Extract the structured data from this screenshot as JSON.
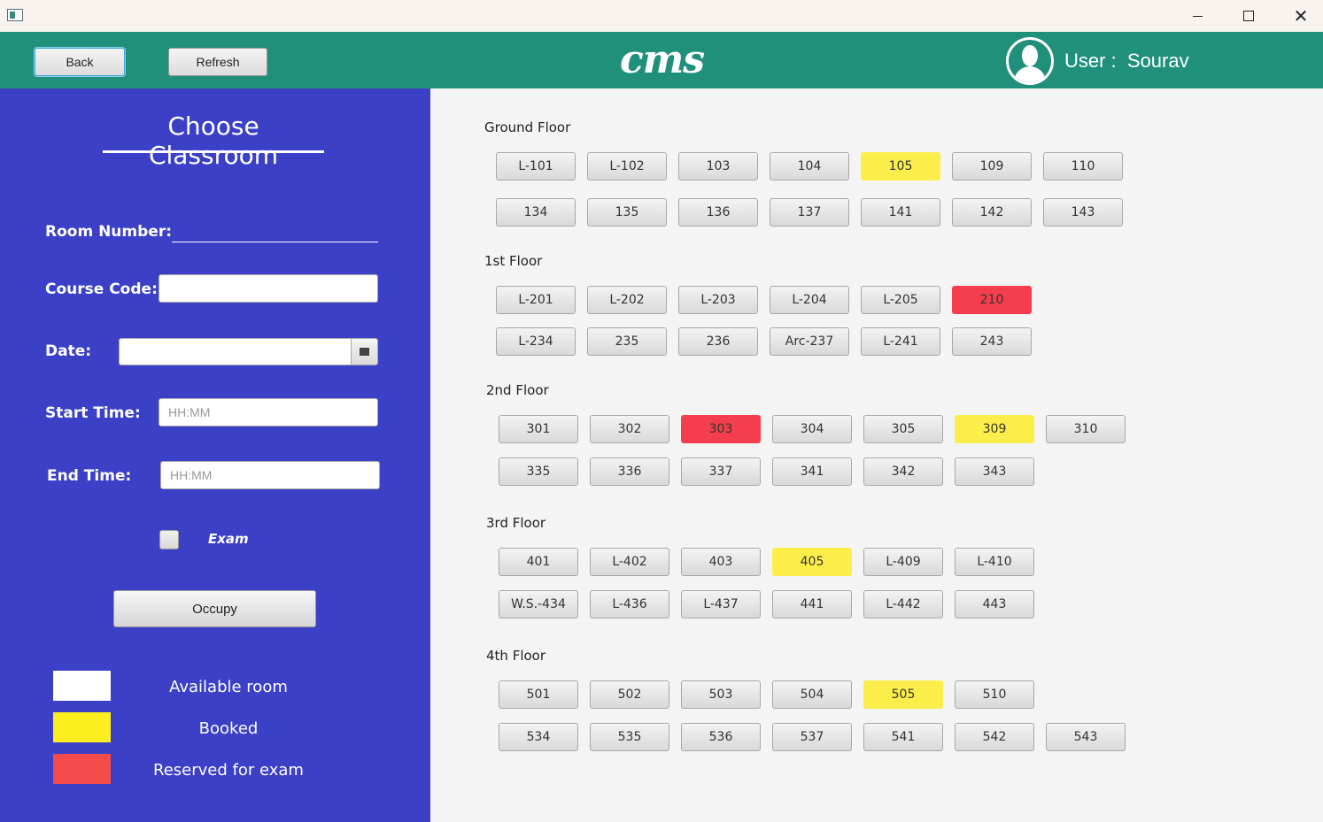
{
  "window": {
    "minimize_icon": "minimize-icon",
    "maximize_icon": "maximize-icon",
    "close_glyph": "✕"
  },
  "header": {
    "back_label": "Back",
    "refresh_label": "Refresh",
    "logo_text": "cms",
    "user_text": "User :  Sourav",
    "background": "#21907a"
  },
  "sidebar": {
    "title": "Choose Classroom",
    "room_number_label": "Room Number:",
    "course_code_label": "Course Code:",
    "date_label": "Date:",
    "start_time_label": "Start Time:",
    "start_time_placeholder": "HH:MM",
    "end_time_label": "End Time:",
    "end_time_placeholder": "HH:MM",
    "exam_label": "Exam",
    "occupy_label": "Occupy",
    "background": "#3c40c6",
    "legend": [
      {
        "label": "Available room",
        "color": "#ffffff"
      },
      {
        "label": "Booked",
        "color": "#fcee1e"
      },
      {
        "label": "Reserved for exam",
        "color": "#f44a4a"
      }
    ]
  },
  "floors": [
    {
      "label": "Ground Floor",
      "rows": [
        [
          {
            "name": "L-101",
            "status": "available"
          },
          {
            "name": "L-102",
            "status": "available"
          },
          {
            "name": "103",
            "status": "available"
          },
          {
            "name": "104",
            "status": "available"
          },
          {
            "name": "105",
            "status": "booked"
          },
          {
            "name": "109",
            "status": "available"
          },
          {
            "name": "110",
            "status": "available"
          }
        ],
        [
          {
            "name": "134",
            "status": "available"
          },
          {
            "name": "135",
            "status": "available"
          },
          {
            "name": "136",
            "status": "available"
          },
          {
            "name": "137",
            "status": "available"
          },
          {
            "name": "141",
            "status": "available"
          },
          {
            "name": "142",
            "status": "available"
          },
          {
            "name": "143",
            "status": "available"
          }
        ]
      ]
    },
    {
      "label": "1st Floor",
      "rows": [
        [
          {
            "name": "L-201",
            "status": "available"
          },
          {
            "name": "L-202",
            "status": "available"
          },
          {
            "name": "L-203",
            "status": "available"
          },
          {
            "name": "L-204",
            "status": "available"
          },
          {
            "name": "L-205",
            "status": "available"
          },
          {
            "name": "210",
            "status": "exam"
          }
        ],
        [
          {
            "name": "L-234",
            "status": "available"
          },
          {
            "name": "235",
            "status": "available"
          },
          {
            "name": "236",
            "status": "available"
          },
          {
            "name": "Arc-237",
            "status": "available"
          },
          {
            "name": "L-241",
            "status": "available"
          },
          {
            "name": "243",
            "status": "available"
          }
        ]
      ]
    },
    {
      "label": "2nd Floor",
      "rows": [
        [
          {
            "name": "301",
            "status": "available"
          },
          {
            "name": "302",
            "status": "available"
          },
          {
            "name": "303",
            "status": "exam"
          },
          {
            "name": "304",
            "status": "available"
          },
          {
            "name": "305",
            "status": "available"
          },
          {
            "name": "309",
            "status": "booked"
          },
          {
            "name": "310",
            "status": "available"
          }
        ],
        [
          {
            "name": "335",
            "status": "available"
          },
          {
            "name": "336",
            "status": "available"
          },
          {
            "name": "337",
            "status": "available"
          },
          {
            "name": "341",
            "status": "available"
          },
          {
            "name": "342",
            "status": "available"
          },
          {
            "name": "343",
            "status": "available"
          }
        ]
      ]
    },
    {
      "label": "3rd Floor",
      "rows": [
        [
          {
            "name": "401",
            "status": "available"
          },
          {
            "name": "L-402",
            "status": "available"
          },
          {
            "name": "403",
            "status": "available"
          },
          {
            "name": "405",
            "status": "booked"
          },
          {
            "name": "L-409",
            "status": "available"
          },
          {
            "name": "L-410",
            "status": "available"
          }
        ],
        [
          {
            "name": "W.S.-434",
            "status": "available"
          },
          {
            "name": "L-436",
            "status": "available"
          },
          {
            "name": "L-437",
            "status": "available"
          },
          {
            "name": "441",
            "status": "available"
          },
          {
            "name": "L-442",
            "status": "available"
          },
          {
            "name": "443",
            "status": "available"
          }
        ]
      ]
    },
    {
      "label": "4th Floor",
      "rows": [
        [
          {
            "name": "501",
            "status": "available"
          },
          {
            "name": "502",
            "status": "available"
          },
          {
            "name": "503",
            "status": "available"
          },
          {
            "name": "504",
            "status": "available"
          },
          {
            "name": "505",
            "status": "booked"
          },
          {
            "name": "510",
            "status": "available"
          }
        ],
        [
          {
            "name": "534",
            "status": "available"
          },
          {
            "name": "535",
            "status": "available"
          },
          {
            "name": "536",
            "status": "available"
          },
          {
            "name": "537",
            "status": "available"
          },
          {
            "name": "541",
            "status": "available"
          },
          {
            "name": "542",
            "status": "available"
          },
          {
            "name": "543",
            "status": "available"
          }
        ]
      ]
    }
  ]
}
